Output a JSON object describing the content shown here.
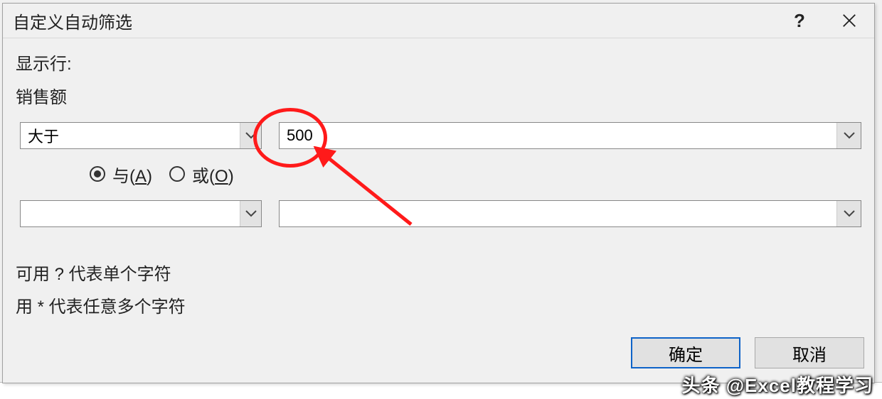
{
  "titlebar": {
    "title": "自定义自动筛选",
    "help": "?",
    "close": "×"
  },
  "body": {
    "show_rows_label": "显示行:",
    "column_label": "销售额",
    "row1": {
      "operator": "大于",
      "value": "500"
    },
    "radios": {
      "and_label": "与(",
      "and_key": "A",
      "and_close": ")",
      "or_label": "或(",
      "or_key": "O",
      "or_close": ")"
    },
    "row2": {
      "operator": "",
      "value": ""
    },
    "hint1": "可用 ? 代表单个字符",
    "hint2": "用 * 代表任意多个字符"
  },
  "buttons": {
    "ok": "确定",
    "cancel": "取消"
  },
  "watermark": "头条 @Excel教程学习"
}
